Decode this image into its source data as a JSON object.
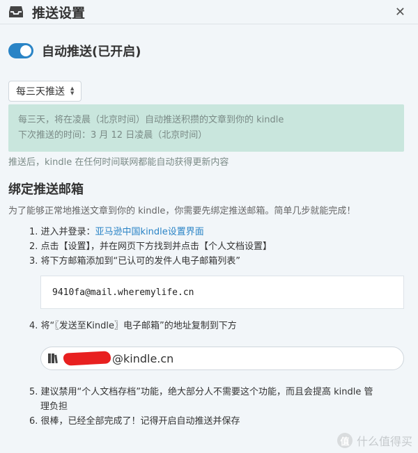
{
  "header": {
    "title": "推送设置",
    "close_glyph": "✕"
  },
  "toggle": {
    "label": "自动推送(已开启)",
    "on": true,
    "color": "#2a84c6"
  },
  "frequency": {
    "selected": "每三天推送"
  },
  "info": {
    "line1": "每三天，将在凌晨（北京时间）自动推送积攒的文章到你的 kindle",
    "line2": "下次推送的时间：3 月 12 日凌晨（北京时间）"
  },
  "note": "推送后，kindle 在任何时间联网都能自动获得更新内容",
  "bind_section": {
    "title": "绑定推送邮箱",
    "desc": "为了能够正常地推送文章到你的 kindle，你需要先绑定推送邮箱。简单几步就能完成！"
  },
  "steps": {
    "s1_prefix": "1. 进入并登录：",
    "s1_link": "亚马逊中国kindle设置界面",
    "s2": "2. 点击【设置】，并在网页下方找到并点击【个人文档设置】",
    "s3": "3. 将下方邮箱添加到“已认可的发件人电子邮箱列表”",
    "s4": "4. 将“〖发送至Kindle〗电子邮箱”的地址复制到下方",
    "s5a": "5. 建议禁用“个人文档存档”功能，绝大部分人不需要这个功能，而且会提高 kindle 管",
    "s5b": "理负担",
    "s6": "6. 很棒，已经全部完成了！记得开启自动推送并保存"
  },
  "sender_email": "9410fa@mail.wheremylife.cn",
  "kindle_email": {
    "suffix": "@kindle.cn"
  },
  "watermark": {
    "badge": "值",
    "text": "什么值得买"
  },
  "colors": {
    "accent": "#2a84c6",
    "info_bg": "#c9e6dd",
    "redaction": "#e82020"
  }
}
